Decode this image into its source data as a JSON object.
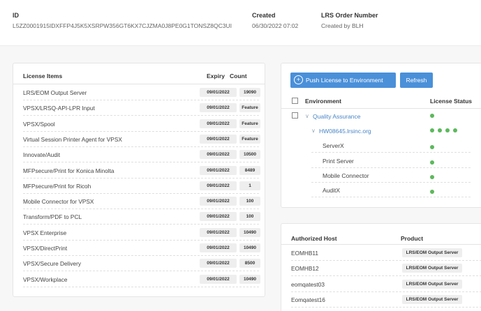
{
  "header": {
    "id_label": "ID",
    "id_value": "L5ZZ0001915IDXFFP4J5K5XSRPW356GT6KX7CJZMA0J8PE0G1TONSZ8QC3UI",
    "created_label": "Created",
    "created_value": "06/30/2022 07:02",
    "order_label": "LRS Order Number",
    "order_value": "Created by BLH"
  },
  "licenses": {
    "col_items": "License Items",
    "col_expiry": "Expiry",
    "col_count": "Count",
    "rows": [
      {
        "name": "LRS/EOM Output Server",
        "expiry": "09/01/2022",
        "count": "19090"
      },
      {
        "name": "VPSX/LRSQ-API-LPR Input",
        "expiry": "09/01/2022",
        "count": "Feature"
      },
      {
        "name": "VPSX/Spool",
        "expiry": "09/01/2022",
        "count": "Feature"
      },
      {
        "name": "Virtual Session Printer Agent for VPSX",
        "expiry": "09/01/2022",
        "count": "Feature"
      },
      {
        "name": "Innovate/Audit",
        "expiry": "09/01/2022",
        "count": "10500"
      },
      {
        "name": "MFPsecure/Print for Konica Minolta",
        "expiry": "09/01/2022",
        "count": "8489"
      },
      {
        "name": "MFPsecure/Print for Ricoh",
        "expiry": "09/01/2022",
        "count": "1"
      },
      {
        "name": "Mobile Connector for VPSX",
        "expiry": "09/01/2022",
        "count": "100"
      },
      {
        "name": "Transform/PDF to PCL",
        "expiry": "09/01/2022",
        "count": "100"
      },
      {
        "name": "VPSX Enterprise",
        "expiry": "09/01/2022",
        "count": "10490"
      },
      {
        "name": "VPSX/DirectPrint",
        "expiry": "09/01/2022",
        "count": "10490"
      },
      {
        "name": "VPSX/Secure Delivery",
        "expiry": "09/01/2022",
        "count": "8500"
      },
      {
        "name": "VPSX/Workplace",
        "expiry": "09/01/2022",
        "count": "10490"
      }
    ]
  },
  "environment": {
    "push_label": "Push License to Environment",
    "refresh_label": "Refresh",
    "col_environment": "Environment",
    "col_status": "License Status",
    "status_color": "#5cb85c",
    "accent_color": "#4a90d9",
    "rows": [
      {
        "name": "Quality Assurance",
        "level": 0,
        "link": true,
        "dots": 1,
        "checkbox": true
      },
      {
        "name": "HW08645.lrsinc.org",
        "level": 1,
        "link": true,
        "dots": 4,
        "checkbox": false
      },
      {
        "name": "ServerX",
        "level": 2,
        "link": false,
        "dots": 1,
        "checkbox": false
      },
      {
        "name": "Print Server",
        "level": 2,
        "link": false,
        "dots": 1,
        "checkbox": false
      },
      {
        "name": "Mobile Connector",
        "level": 2,
        "link": false,
        "dots": 1,
        "checkbox": false
      },
      {
        "name": "AuditX",
        "level": 2,
        "link": false,
        "dots": 1,
        "checkbox": false
      }
    ]
  },
  "hosts": {
    "col_host": "Authorized Host",
    "col_product": "Product",
    "rows": [
      {
        "host": "EOMHB11",
        "product": "LRS/EOM Output Server"
      },
      {
        "host": "EOMHB12",
        "product": "LRS/EOM Output Server"
      },
      {
        "host": "eomqatest03",
        "product": "LRS/EOM Output Server"
      },
      {
        "host": "Eomqatest16",
        "product": "LRS/EOM Output Server"
      }
    ]
  }
}
